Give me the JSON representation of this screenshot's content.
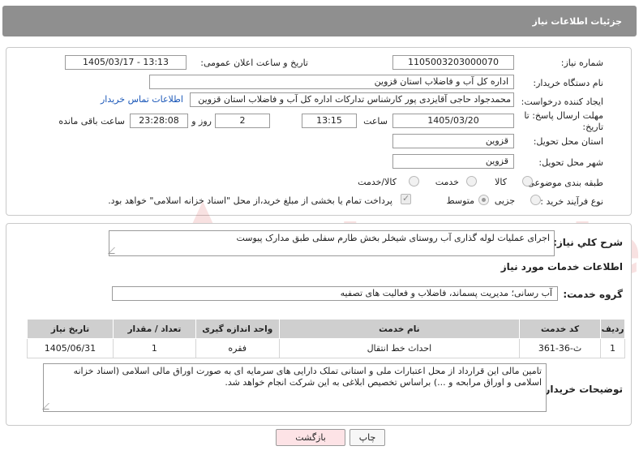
{
  "header": {
    "title": "جزئیات اطلاعات نیاز"
  },
  "form": {
    "need_number_label": "شماره نیاز:",
    "need_number": "1105003203000070",
    "announce_label": "تاریخ و ساعت اعلان عمومی:",
    "announce_value": "1405/03/17 - 13:13",
    "buyer_org_label": "نام دستگاه خریدار:",
    "buyer_org": "اداره کل آب و فاضلاب استان قزوین",
    "creator_label": "ایجاد کننده درخواست:",
    "creator": "محمدجواد حاجی آقایزدی پور کارشناس تدارکات اداره کل آب و فاضلاب استان قزوین",
    "contact_link": "اطلاعات تماس خریدار",
    "deadline_label": "مهلت ارسال پاسخ: تا تاریخ:",
    "deadline_date": "1405/03/20",
    "time_label": "ساعت",
    "deadline_time": "13:15",
    "days_value": "2",
    "days_label": "روز و",
    "remaining_value": "23:28:08",
    "remaining_label": "ساعت باقی مانده",
    "province_label": "استان محل تحویل:",
    "province": "قزوین",
    "city_label": "شهر محل تحویل:",
    "city": "قزوین",
    "category_label": "طبقه بندی موضوعی:",
    "category_options": [
      "کالا",
      "خدمت",
      "کالا/خدمت"
    ],
    "process_label": "نوع فرآیند خرید :",
    "process_options": [
      "جزیی",
      "متوسط"
    ],
    "payment_note": "پرداخت تمام یا بخشی از مبلغ خرید،از محل \"اسناد خزانه اسلامی\" خواهد بود."
  },
  "details": {
    "summary_label": "شرح کلي نياز:",
    "summary": "اجرای عملیات لوله گذاری آب روستای شیخلر بخش طارم سفلی طبق مدارک پیوست",
    "services_title": "اطلاعات خدمات مورد نیاز",
    "service_group_label": "گروه خدمت:",
    "service_group": "آب رسانی؛ مدیریت پسماند، فاضلاب و فعالیت های تصفیه",
    "table": {
      "headers": [
        "ردیف",
        "کد خدمت",
        "نام خدمت",
        "واحد اندازه گیری",
        "تعداد / مقدار",
        "تاریخ نیاز"
      ],
      "rows": [
        [
          "1",
          "ث-36-361",
          "احداث خط انتقال",
          "فقره",
          "1",
          "1405/06/31"
        ]
      ]
    },
    "buyer_notes_label": "توضیحات خریدار:",
    "buyer_notes": "تامین مالی این قرارداد از محل اعتبارات ملی و استانی تملک دارایی های سرمایه ای به صورت اوراق مالی اسلامی (اسناد خزانه اسلامی و اوراق مرابحه و ...) براساس تخصیص ابلاغی به این شرکت انجام خواهد شد."
  },
  "buttons": {
    "print": "چاپ",
    "back": "بازگشت"
  },
  "watermark": {
    "text": "AriaTender.neT",
    "color": "#cc2222"
  }
}
